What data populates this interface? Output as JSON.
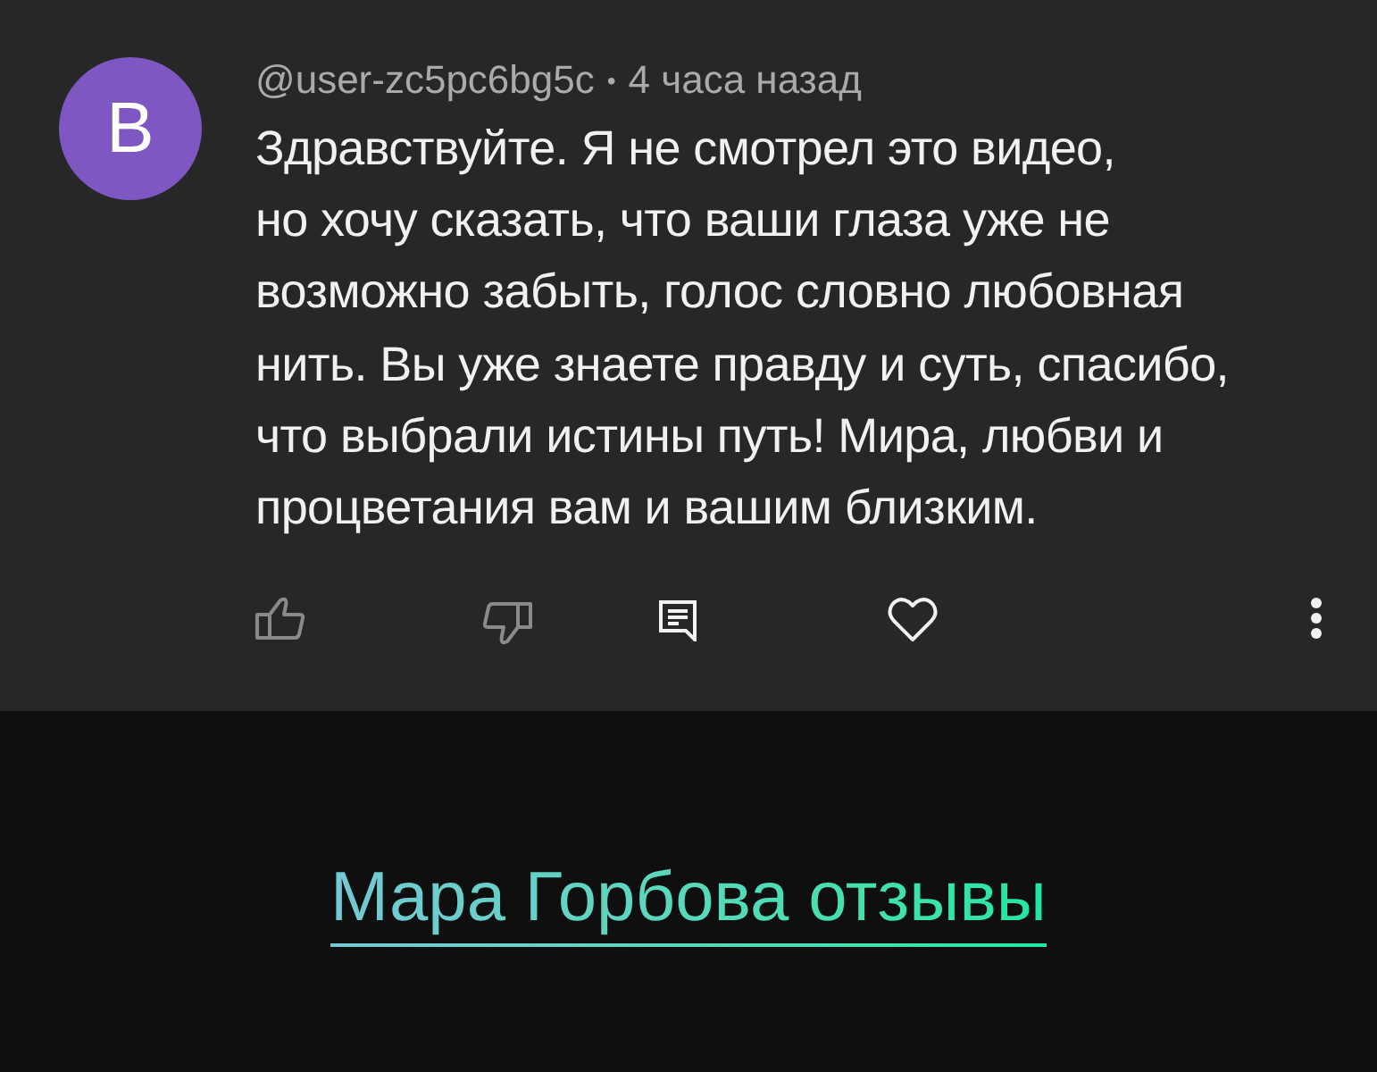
{
  "comment": {
    "avatar_letter": "B",
    "author": "@user-zc5pc6bg5c",
    "separator": "•",
    "time": "4 часа назад",
    "text": "Здравствуйте. Я не смотрел это видео,\nно хочу сказать, что ваши глаза уже не\nвозможно забыть, голос словно любовная\nнить. Вы уже знаете правду и суть, спасибо,\nчто выбрали истины путь! Мира, любви и\nпроцветания вам и вашим близким."
  },
  "link": {
    "text": "Мара Горбова отзывы"
  }
}
